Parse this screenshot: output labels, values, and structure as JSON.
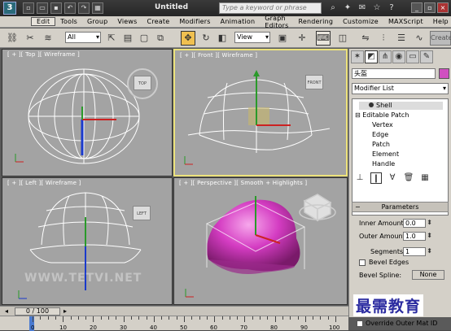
{
  "titlebar": {
    "logo": "3",
    "title": "Untitled",
    "search_placeholder": "Type a keyword or phrase",
    "quick_access": [
      "new-icon",
      "open-icon",
      "save-icon",
      "undo-icon",
      "redo-icon",
      "project-icon"
    ]
  },
  "menu": [
    "Edit",
    "Tools",
    "Group",
    "Views",
    "Create",
    "Modifiers",
    "Animation",
    "Graph Editors",
    "Rendering",
    "Customize",
    "MAXScript",
    "Help"
  ],
  "toolbar": {
    "selection_filter": "All",
    "ref_coord": "View",
    "create_label": "Create"
  },
  "viewports": [
    {
      "label": "[ + ][ Top ][ Wireframe ]",
      "cube": "TOP"
    },
    {
      "label": "[ + ][ Front ][ Wireframe ]",
      "cube": "FRONT"
    },
    {
      "label": "[ + ][ Left ][ Wireframe ]",
      "cube": "LEFT"
    },
    {
      "label": "[ + ][ Perspective ][ Smooth + Highlights ]",
      "cube": ""
    }
  ],
  "panel": {
    "object_name": "头盔",
    "object_color": "#d050c0",
    "modifier_list": "Modifier List",
    "stack": [
      "Shell",
      "Editable Patch",
      "Vertex",
      "Edge",
      "Patch",
      "Element",
      "Handle"
    ],
    "rollout_title": "Parameters",
    "inner_amount_label": "Inner Amount:",
    "inner_amount": "0.0",
    "outer_amount_label": "Outer Amount:",
    "outer_amount": "1.0",
    "segments_label": "Segments:",
    "segments": "1",
    "bevel_edges": "Bevel Edges",
    "bevel_spline_label": "Bevel Spline:",
    "bevel_spline_value": "None",
    "override_label": "Override Outer Mat ID"
  },
  "timeline": {
    "frame": "0 / 100",
    "ticks": [
      "0",
      "10",
      "20",
      "30",
      "40",
      "50",
      "60",
      "70",
      "80",
      "90",
      "100"
    ]
  },
  "watermark": "WWW.TETVI.NET",
  "overlay_text": "最需教育"
}
